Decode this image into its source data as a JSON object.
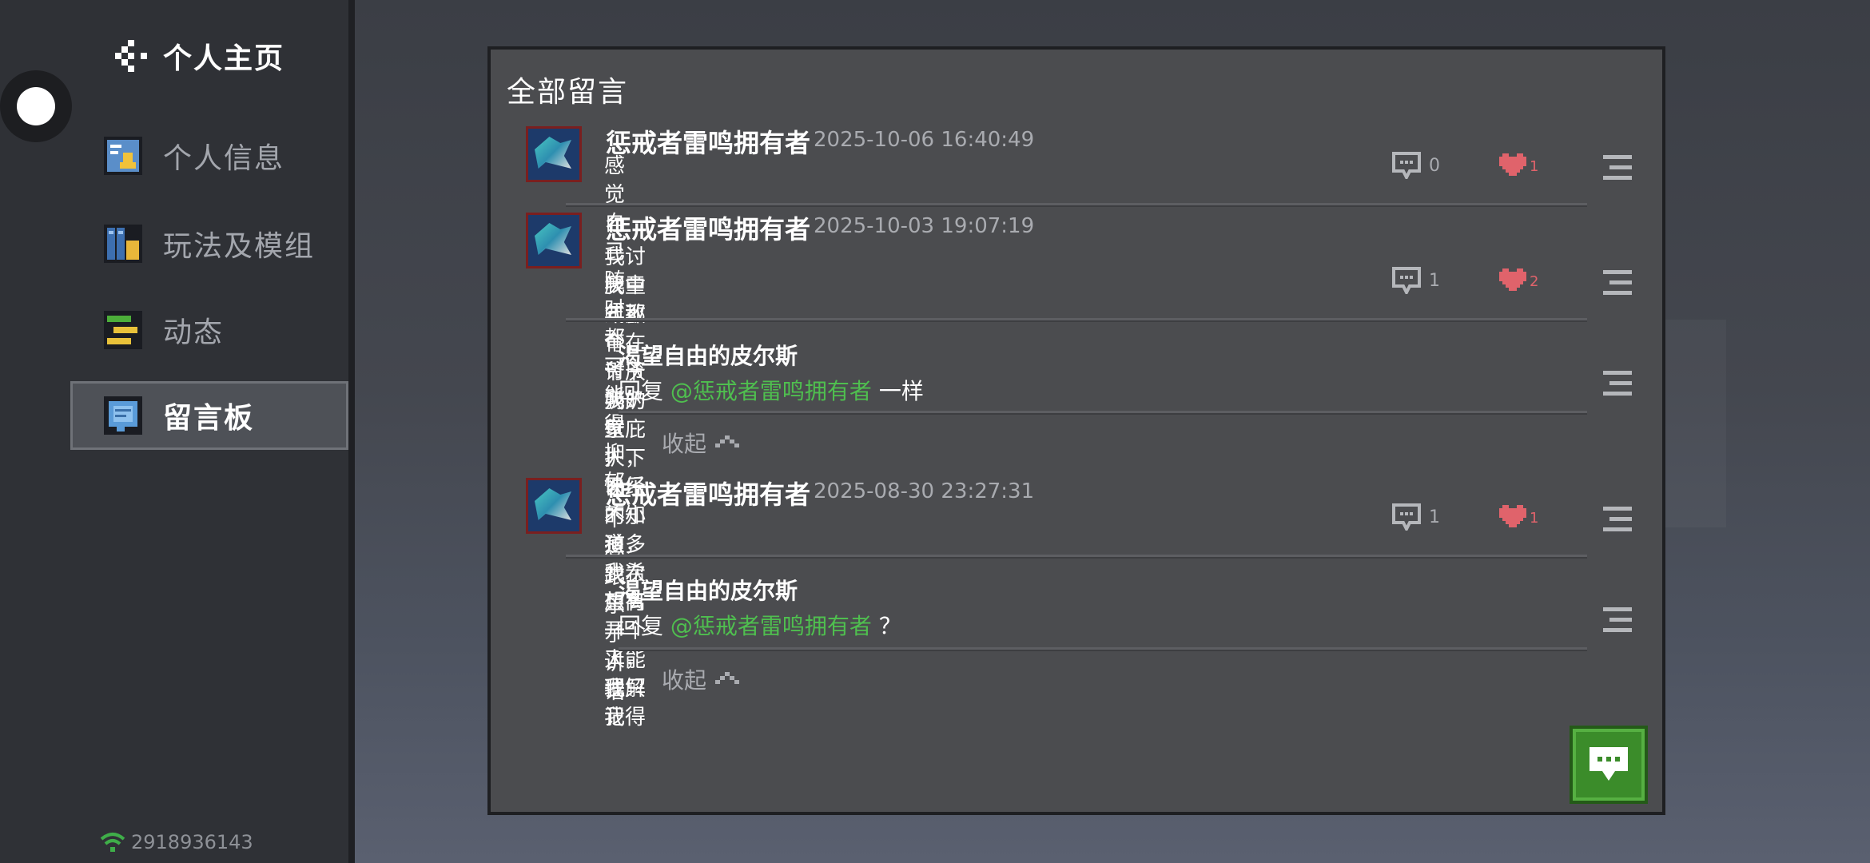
{
  "sidebar": {
    "title": "个人主页",
    "items": [
      {
        "label": "个人信息",
        "icon": "profile-card-icon"
      },
      {
        "label": "玩法及模组",
        "icon": "mods-icon"
      },
      {
        "label": "动态",
        "icon": "feed-icon"
      },
      {
        "label": "留言板",
        "icon": "message-board-icon",
        "active": true
      }
    ],
    "uid": "2918936143"
  },
  "panel": {
    "title": "全部留言",
    "comments": [
      {
        "author": "惩戒者雷鸣拥有者",
        "time": "2025-10-06 16:40:49",
        "text": "感觉自己随时都可能得抑郁",
        "reply_count": "0",
        "likes": "1"
      },
      {
        "author": "惩戒者雷鸣拥有者",
        "time": "2025-10-03 19:07:19",
        "text_line1": "我讨厌中式教育，讨厌我的家人，已经不知道多少次想离开了，我只记得",
        "text_line2": "我童年那个在爷爷奶奶壁庇护下快乐的小孩，我希望有一个人能理解我",
        "reply_count": "1",
        "likes": "2",
        "reply": {
          "author": "渴望自由的皮尔斯",
          "prefix": "回复",
          "mention": "@惩戒者雷鸣拥有者",
          "text": "一样"
        },
        "collapse": "收起"
      },
      {
        "author": "惩戒者雷鸣拥有者",
        "time": "2025-08-30 23:27:31",
        "text": "不想跟乐子讲话",
        "reply_count": "1",
        "likes": "1",
        "reply": {
          "author": "渴望自由的皮尔斯",
          "prefix": "回复",
          "mention": "@惩戒者雷鸣拥有者",
          "text": "？"
        },
        "collapse": "收起"
      }
    ]
  },
  "colors": {
    "accent_green": "#3b8c2a",
    "mention_green": "#4fbf4f",
    "heart_red": "#e0636b"
  }
}
